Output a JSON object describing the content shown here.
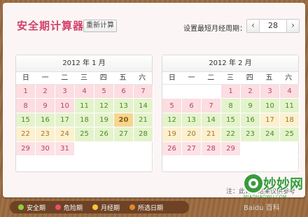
{
  "header": {
    "title": "安全期计算器",
    "recalc_label": "重新计算",
    "cycle_label": "设置最短月经周期：",
    "cycle_value": "28",
    "prev_symbol": "‹",
    "next_symbol": "›"
  },
  "weekdays": [
    "日",
    "一",
    "二",
    "三",
    "四",
    "五",
    "六"
  ],
  "calendars": [
    {
      "title": "2012 年  1 月",
      "days": [
        {
          "n": "1",
          "t": "d"
        },
        {
          "n": "2",
          "t": "d"
        },
        {
          "n": "3",
          "t": "d"
        },
        {
          "n": "4",
          "t": "d"
        },
        {
          "n": "5",
          "t": "d"
        },
        {
          "n": "6",
          "t": "d"
        },
        {
          "n": "7",
          "t": "d"
        },
        {
          "n": "8",
          "t": "d"
        },
        {
          "n": "9",
          "t": "d"
        },
        {
          "n": "10",
          "t": "d"
        },
        {
          "n": "11",
          "t": "s"
        },
        {
          "n": "12",
          "t": "s"
        },
        {
          "n": "13",
          "t": "s"
        },
        {
          "n": "14",
          "t": "s"
        },
        {
          "n": "15",
          "t": "s"
        },
        {
          "n": "16",
          "t": "s"
        },
        {
          "n": "17",
          "t": "s"
        },
        {
          "n": "18",
          "t": "s"
        },
        {
          "n": "19",
          "t": "s"
        },
        {
          "n": "20",
          "t": "sel"
        },
        {
          "n": "21",
          "t": "s"
        },
        {
          "n": "22",
          "t": "p"
        },
        {
          "n": "23",
          "t": "p"
        },
        {
          "n": "24",
          "t": "p"
        },
        {
          "n": "25",
          "t": "s"
        },
        {
          "n": "26",
          "t": "s"
        },
        {
          "n": "27",
          "t": "s"
        },
        {
          "n": "28",
          "t": "s"
        },
        {
          "n": "29",
          "t": "m"
        },
        {
          "n": "30",
          "t": "m"
        },
        {
          "n": "31",
          "t": "m"
        }
      ],
      "lead": 0
    },
    {
      "title": "2012 年  2 月",
      "days": [
        {
          "n": "1",
          "t": "d"
        },
        {
          "n": "2",
          "t": "d"
        },
        {
          "n": "3",
          "t": "d"
        },
        {
          "n": "4",
          "t": "d"
        },
        {
          "n": "5",
          "t": "d"
        },
        {
          "n": "6",
          "t": "d"
        },
        {
          "n": "7",
          "t": "d"
        },
        {
          "n": "8",
          "t": "s"
        },
        {
          "n": "9",
          "t": "s"
        },
        {
          "n": "10",
          "t": "s"
        },
        {
          "n": "11",
          "t": "s"
        },
        {
          "n": "12",
          "t": "s"
        },
        {
          "n": "13",
          "t": "s"
        },
        {
          "n": "14",
          "t": "s"
        },
        {
          "n": "15",
          "t": "s"
        },
        {
          "n": "16",
          "t": "s"
        },
        {
          "n": "17",
          "t": "p"
        },
        {
          "n": "18",
          "t": "p"
        },
        {
          "n": "19",
          "t": "p"
        },
        {
          "n": "20",
          "t": "p"
        },
        {
          "n": "21",
          "t": "p"
        },
        {
          "n": "22",
          "t": "s"
        },
        {
          "n": "23",
          "t": "s"
        },
        {
          "n": "24",
          "t": "s"
        },
        {
          "n": "25",
          "t": "s"
        },
        {
          "n": "26",
          "t": "m"
        },
        {
          "n": "27",
          "t": "m"
        },
        {
          "n": "28",
          "t": "m"
        },
        {
          "n": "29",
          "t": "m"
        }
      ],
      "lead": 3
    }
  ],
  "note": "注：此计算结果仅供参考",
  "legend": [
    {
      "label": "安全期",
      "color": "#8fcf3c"
    },
    {
      "label": "危险期",
      "color": "#e8506e"
    },
    {
      "label": "月经期",
      "color": "#f6c542"
    },
    {
      "label": "所选日期",
      "color": "#e08a2c"
    }
  ],
  "watermark": {
    "brand": "妙妙网",
    "url": "MIAOHAOWU.COM",
    "sub": "Baidu 百科"
  }
}
